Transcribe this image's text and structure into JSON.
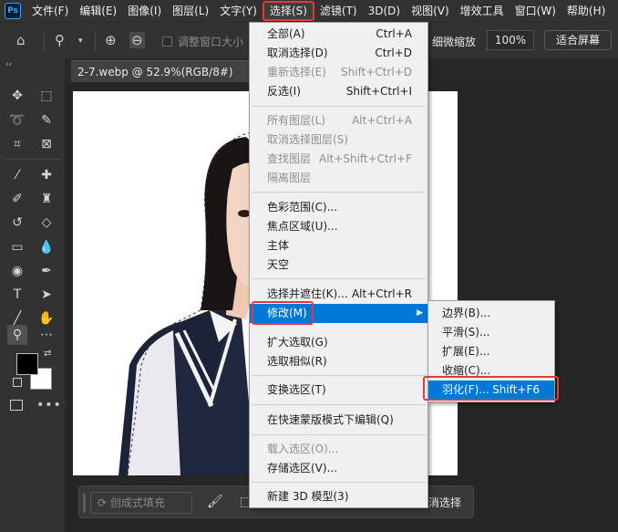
{
  "menubar": {
    "logo": "Ps",
    "items": [
      "文件(F)",
      "编辑(E)",
      "图像(I)",
      "图层(L)",
      "文字(Y)",
      "选择(S)",
      "滤镜(T)",
      "3D(D)",
      "视图(V)",
      "增效工具",
      "窗口(W)",
      "帮助(H)"
    ],
    "active_index": 5
  },
  "options_bar": {
    "resize_windows_label": "调整窗口大小",
    "fine_zoom_label": "细微缩放",
    "zoom_value": "100%",
    "fit_screen_label": "适合屏幕"
  },
  "toolbar": {
    "collapse_label": "‹‹"
  },
  "document": {
    "tab_title": "2-7.webp @ 52.9%(RGB/8#)"
  },
  "context_bar": {
    "generative_fill_label": "创成式填充",
    "deselect_label": "消选择"
  },
  "select_menu": {
    "items": [
      {
        "label": "全部(A)",
        "shortcut": "Ctrl+A",
        "enabled": true
      },
      {
        "label": "取消选择(D)",
        "shortcut": "Ctrl+D",
        "enabled": true
      },
      {
        "label": "重新选择(E)",
        "shortcut": "Shift+Ctrl+D",
        "enabled": false
      },
      {
        "label": "反选(I)",
        "shortcut": "Shift+Ctrl+I",
        "enabled": true
      },
      {
        "label": "所有图层(L)",
        "shortcut": "Alt+Ctrl+A",
        "enabled": false
      },
      {
        "label": "取消选择图层(S)",
        "shortcut": "",
        "enabled": false
      },
      {
        "label": "查找图层",
        "shortcut": "Alt+Shift+Ctrl+F",
        "enabled": false
      },
      {
        "label": "隔离图层",
        "shortcut": "",
        "enabled": false
      },
      {
        "label": "色彩范围(C)...",
        "shortcut": "",
        "enabled": true
      },
      {
        "label": "焦点区域(U)...",
        "shortcut": "",
        "enabled": true
      },
      {
        "label": "主体",
        "shortcut": "",
        "enabled": true
      },
      {
        "label": "天空",
        "shortcut": "",
        "enabled": true
      },
      {
        "label": "选择并遮住(K)...",
        "shortcut": "Alt+Ctrl+R",
        "enabled": true
      },
      {
        "label": "修改(M)",
        "shortcut": "",
        "enabled": true,
        "highlighted": true
      },
      {
        "label": "扩大选取(G)",
        "shortcut": "",
        "enabled": true
      },
      {
        "label": "选取相似(R)",
        "shortcut": "",
        "enabled": true
      },
      {
        "label": "变换选区(T)",
        "shortcut": "",
        "enabled": true
      },
      {
        "label": "在快速蒙版模式下编辑(Q)",
        "shortcut": "",
        "enabled": true
      },
      {
        "label": "载入选区(O)...",
        "shortcut": "",
        "enabled": false
      },
      {
        "label": "存储选区(V)...",
        "shortcut": "",
        "enabled": true
      },
      {
        "label": "新建 3D 模型(3)",
        "shortcut": "",
        "enabled": true
      }
    ]
  },
  "modify_submenu": {
    "items": [
      {
        "label": "边界(B)...",
        "shortcut": ""
      },
      {
        "label": "平滑(S)...",
        "shortcut": ""
      },
      {
        "label": "扩展(E)...",
        "shortcut": ""
      },
      {
        "label": "收缩(C)...",
        "shortcut": ""
      },
      {
        "label": "羽化(F)...",
        "shortcut": "Shift+F6",
        "highlighted": true
      }
    ]
  },
  "colors": {
    "highlight": "#0078d7",
    "annotation_red": "#e33b3b",
    "menu_bg": "#f0f0f0",
    "app_bg": "#323232"
  }
}
